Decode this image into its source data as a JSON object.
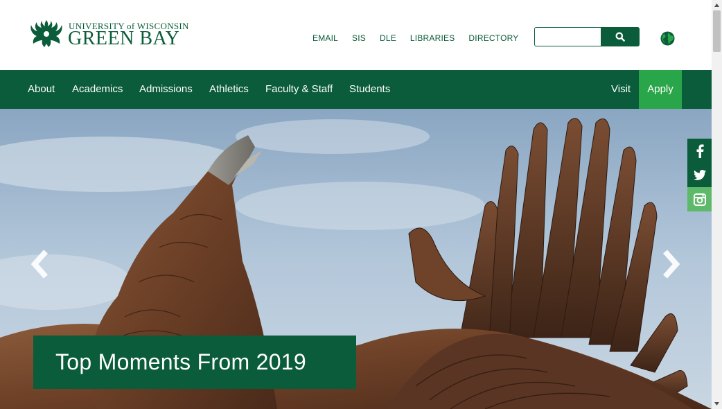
{
  "header": {
    "logo_line1": "UNIVERSITY of WISCONSIN",
    "logo_line2": "GREEN BAY"
  },
  "utility_links": [
    "EMAIL",
    "SIS",
    "DLE",
    "LIBRARIES",
    "DIRECTORY"
  ],
  "search": {
    "placeholder": "",
    "value": "",
    "icon": "search-icon"
  },
  "language_icon": "globe-icon",
  "nav": {
    "items": [
      "About",
      "Academics",
      "Admissions",
      "Athletics",
      "Faculty & Staff",
      "Students"
    ],
    "visit": "Visit",
    "apply": "Apply"
  },
  "hero": {
    "caption": "Top Moments From 2019",
    "prev_icon": "chevron-left-icon",
    "next_icon": "chevron-right-icon"
  },
  "social": [
    "facebook-icon",
    "twitter-icon",
    "instagram-icon"
  ],
  "colors": {
    "brand_green": "#0a5c3a",
    "accent_green": "#2aa64a",
    "social_light": "#5fb96b"
  }
}
